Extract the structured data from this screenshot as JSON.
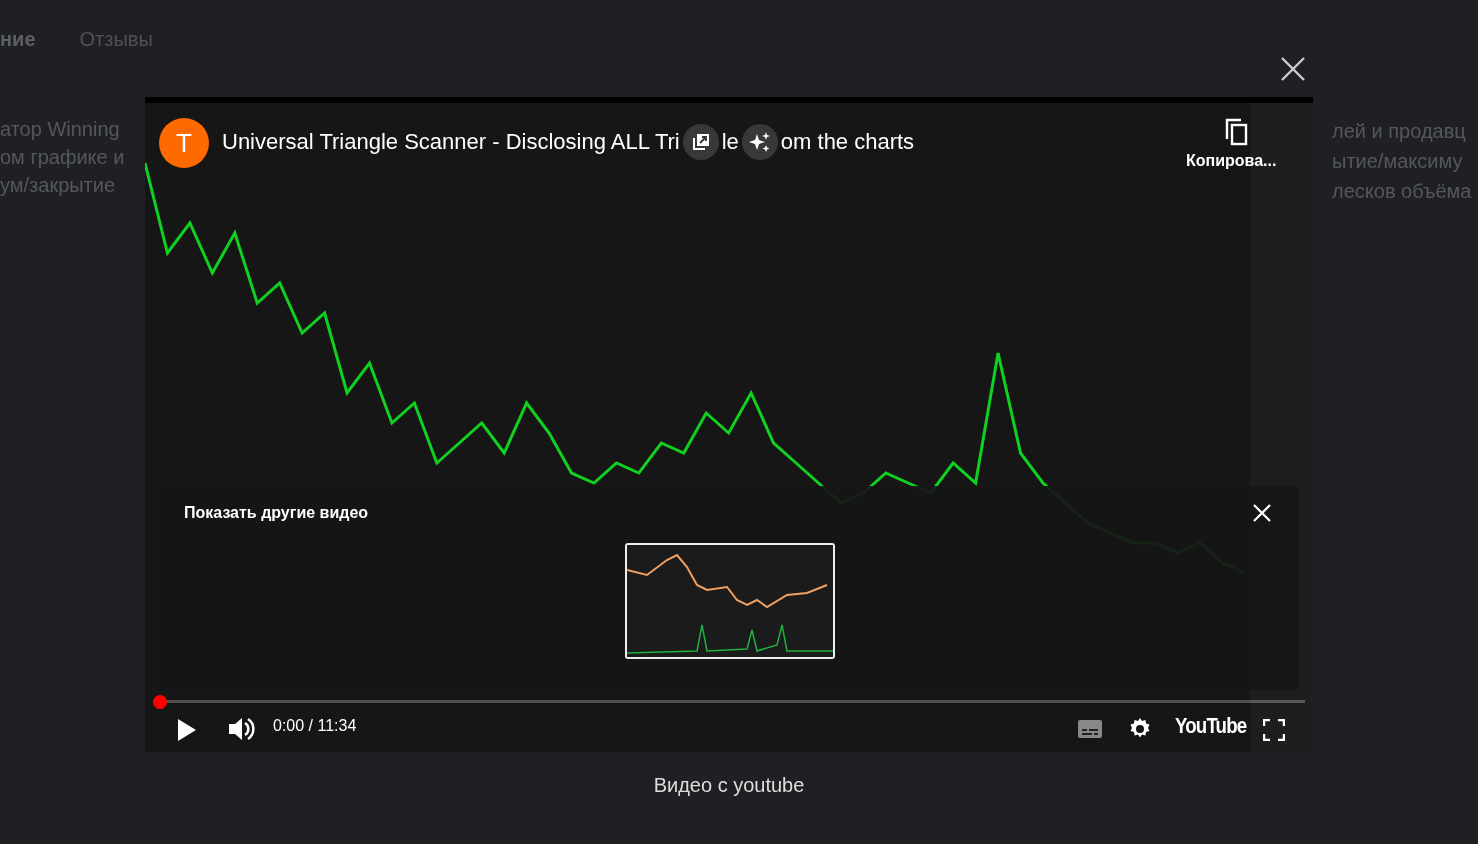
{
  "background_page": {
    "tabs": [
      {
        "label": "ние",
        "selected": true
      },
      {
        "label": "Отзывы",
        "selected": false
      }
    ],
    "left_lines": [
      "атор Winning",
      "ом графике и",
      "ум/закрытие"
    ],
    "right_lines": [
      "лей и продавц",
      "ытие/максиму",
      "лесков объёма"
    ]
  },
  "lightbox": {
    "caption": "Видео с youtube"
  },
  "player": {
    "channel_initial": "T",
    "title_start": "Universal Triangle Scanner - Disclosing ALL Tri",
    "title_mid": "le",
    "title_end": "om the charts",
    "copy_label": "Копирова...",
    "more_videos": {
      "title": "Показать другие видео"
    },
    "progress": {
      "level": 0
    },
    "time": "0:00 / 11:34",
    "logo": "YouTube"
  }
}
